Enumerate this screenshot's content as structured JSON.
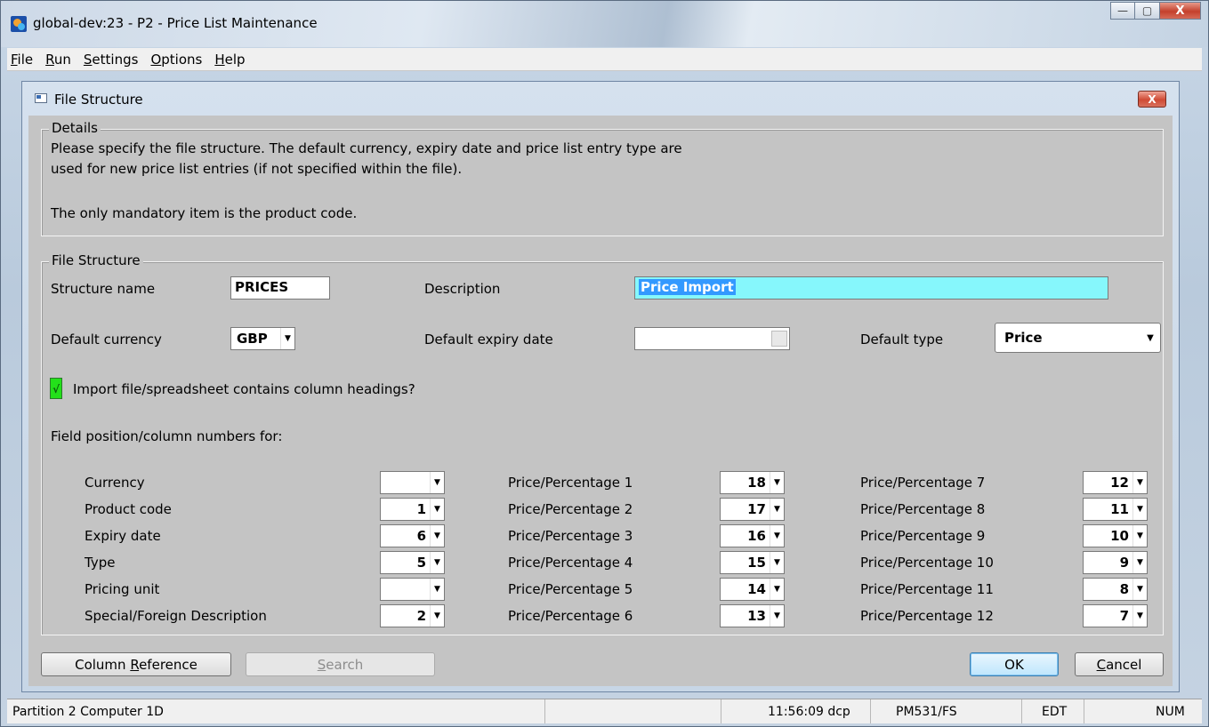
{
  "window": {
    "title": "global-dev:23 - P2 - Price List Maintenance",
    "minimize": "—",
    "maximize": "▢",
    "close": "X"
  },
  "menu": [
    {
      "label": "File"
    },
    {
      "label": "Run"
    },
    {
      "label": "Settings"
    },
    {
      "label": "Options"
    },
    {
      "label": "Help"
    }
  ],
  "dialog": {
    "title": "File Structure",
    "close": "X",
    "details": {
      "label": "Details",
      "line1": "Please specify the file structure. The default currency, expiry date and price list entry type are",
      "line2": "used for new price list entries (if not specified within the file).",
      "line3": "The only mandatory item is the product code."
    },
    "structure": {
      "label": "File Structure",
      "structure_name_label": "Structure name",
      "structure_name_value": "PRICES",
      "description_label": "Description",
      "description_value": "Price Import",
      "currency_label": "Default currency",
      "currency_value": "GBP",
      "expiry_label": "Default expiry date",
      "expiry_value": "",
      "type_label": "Default type",
      "type_value": "Price",
      "headings_checkbox_label": "Import file/spreadsheet contains column headings?",
      "headings_checked": true,
      "field_positions_label": "Field position/column numbers for:",
      "col1": [
        {
          "label": "Currency",
          "value": ""
        },
        {
          "label": "Product code",
          "value": "1"
        },
        {
          "label": "Expiry date",
          "value": "6"
        },
        {
          "label": "Type",
          "value": "5"
        },
        {
          "label": "Pricing unit",
          "value": ""
        },
        {
          "label": "Special/Foreign Description",
          "value": "2"
        }
      ],
      "col2": [
        {
          "label": "Price/Percentage 1",
          "value": "18"
        },
        {
          "label": "Price/Percentage 2",
          "value": "17"
        },
        {
          "label": "Price/Percentage 3",
          "value": "16"
        },
        {
          "label": "Price/Percentage 4",
          "value": "15"
        },
        {
          "label": "Price/Percentage 5",
          "value": "14"
        },
        {
          "label": "Price/Percentage 6",
          "value": "13"
        }
      ],
      "col3": [
        {
          "label": "Price/Percentage 7",
          "value": "12"
        },
        {
          "label": "Price/Percentage 8",
          "value": "11"
        },
        {
          "label": "Price/Percentage 9",
          "value": "10"
        },
        {
          "label": "Price/Percentage 10",
          "value": "9"
        },
        {
          "label": "Price/Percentage 11",
          "value": "8"
        },
        {
          "label": "Price/Percentage 12",
          "value": "7"
        }
      ]
    },
    "buttons": {
      "column_reference_pre": "Column ",
      "column_reference_key": "R",
      "column_reference_post": "eference",
      "search_key": "S",
      "search_post": "earch",
      "ok": "OK",
      "cancel_key": "C",
      "cancel_post": "ancel"
    }
  },
  "status": {
    "partition": "Partition 2 Computer 1D",
    "time": "11:56:09",
    "user": "dcp",
    "program": "PM531/FS",
    "mode": "EDT",
    "num": "NUM"
  }
}
